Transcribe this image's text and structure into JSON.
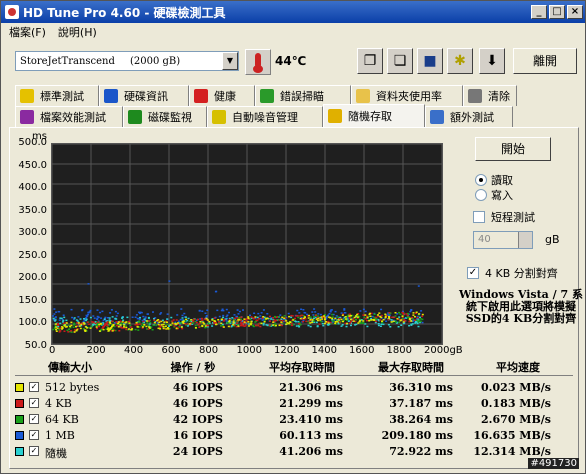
{
  "window": {
    "title": "HD Tune Pro 4.60 - 硬碟檢測工具"
  },
  "menu": [
    "檔案(F)",
    "說明(H)"
  ],
  "toolbar": {
    "drive_name": "StoreJetTranscend",
    "drive_size": "(2000 gB)",
    "temperature": "44℃",
    "exit_label": "離開"
  },
  "tabs_row1": [
    {
      "label": "標準測試",
      "icon": "bulb-icon",
      "color": "#e5c100"
    },
    {
      "label": "硬碟資訊",
      "icon": "info-icon",
      "color": "#1a56c9"
    },
    {
      "label": "健康",
      "icon": "plus-icon",
      "color": "#d42020"
    },
    {
      "label": "錯誤掃瞄",
      "icon": "magnifier-icon",
      "color": "#2a9a2a"
    },
    {
      "label": "資料夾使用率",
      "icon": "folder-icon",
      "color": "#e8c24a"
    },
    {
      "label": "清除",
      "icon": "trash-icon",
      "color": "#777"
    }
  ],
  "tabs_row2": [
    {
      "label": "檔案效能測試",
      "icon": "file-icon",
      "color": "#8a2aa0"
    },
    {
      "label": "磁碟監視",
      "icon": "chart-icon",
      "color": "#1e8a1e"
    },
    {
      "label": "自動噪音管理",
      "icon": "speaker-icon",
      "color": "#d6c000"
    },
    {
      "label": "隨機存取",
      "icon": "random-icon",
      "color": "#e0b000",
      "active": true
    },
    {
      "label": "額外測試",
      "icon": "grid-icon",
      "color": "#3a6fc9"
    }
  ],
  "controls": {
    "start_label": "開始",
    "read_label": "讀取",
    "write_label": "寫入",
    "short_test_label": "短程測試",
    "short_value": "40",
    "short_unit": "gB",
    "align_label": "4 KB 分割對齊",
    "note": "Windows Vista / 7 系統下啟用此選項將模擬SSD的4 KB分割對齊"
  },
  "graph": {
    "y_unit": "ms",
    "y_ticks": [
      "500.0",
      "450.0",
      "400.0",
      "350.0",
      "300.0",
      "250.0",
      "200.0",
      "150.0",
      "100.0",
      "50.0"
    ],
    "x_ticks": [
      "0",
      "200",
      "400",
      "600",
      "800",
      "1000",
      "1200",
      "1400",
      "1600",
      "1800",
      "2000gB"
    ]
  },
  "table": {
    "headers": [
      "傳輸大小",
      "操作 / 秒",
      "平均存取時間",
      "最大存取時間",
      "平均速度"
    ],
    "rows": [
      {
        "name": "512 bytes",
        "color": "#e6e600",
        "ops": "46 IOPS",
        "avg": "21.306 ms",
        "max": "36.310 ms",
        "speed": "0.023 MB/s"
      },
      {
        "name": "4 KB",
        "color": "#cc1a1a",
        "ops": "46 IOPS",
        "avg": "21.299 ms",
        "max": "37.187 ms",
        "speed": "0.183 MB/s"
      },
      {
        "name": "64 KB",
        "color": "#1aa01a",
        "ops": "42 IOPS",
        "avg": "23.410 ms",
        "max": "38.264 ms",
        "speed": "2.670 MB/s"
      },
      {
        "name": "1 MB",
        "color": "#1a5ad6",
        "ops": "16 IOPS",
        "avg": "60.113 ms",
        "max": "209.180 ms",
        "speed": "16.635 MB/s"
      },
      {
        "name": "隨機",
        "color": "#2ad0d0",
        "ops": "24 IOPS",
        "avg": "41.206 ms",
        "max": "72.922 ms",
        "speed": "12.314 MB/s"
      }
    ]
  },
  "watermark": "#491730"
}
